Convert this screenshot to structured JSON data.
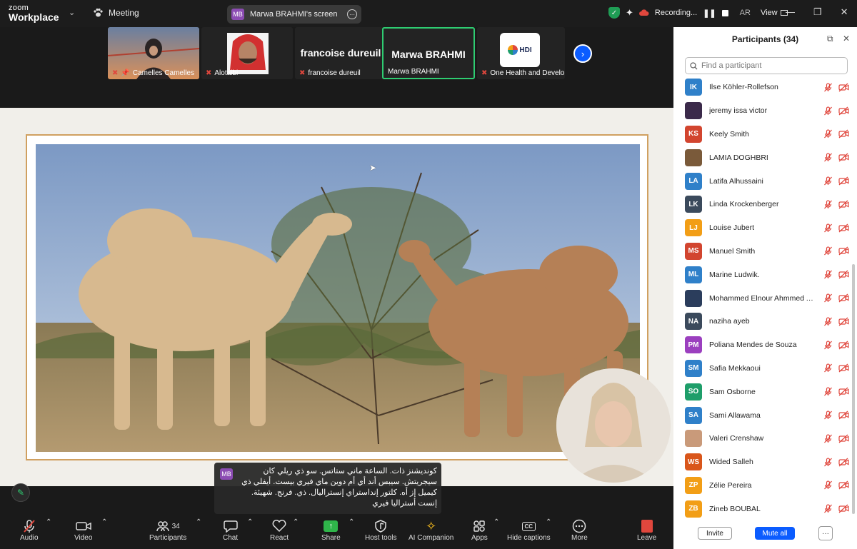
{
  "app": {
    "logo_top": "zoom",
    "logo_bottom": "Workplace"
  },
  "topbar": {
    "meeting_label": "Meeting",
    "screen_badge": "MB",
    "screen_label": "Marwa BRAHMI's screen",
    "recording_label": "Recording...",
    "lang": "AR",
    "view_label": "View"
  },
  "thumbnails": [
    {
      "name": "Camelles Camelles",
      "muted": true
    },
    {
      "name": "Alotaibi",
      "muted": true
    },
    {
      "name": "francoise dureuil",
      "big": "francoise dureuil",
      "muted": true
    },
    {
      "name": "Marwa BRAHMI",
      "big": "Marwa BRAHMI",
      "muted": false
    },
    {
      "name": "One Health and Develo...",
      "logo": "HDI",
      "muted": true
    }
  ],
  "caption": {
    "badge": "MB",
    "text": "كونديشنز ذات. الساعة ماني ستاتس. سو ذي ريلي كان سيجريتش. سيبس أند أي أم دوين ماي فيري بيست. أيفلي ذي كيميل إز أه. كلتور إنداستراي إنستراليال. ذي. فرنج. شهيئة. إنست أستراليا فيري"
  },
  "toolbar": {
    "audio": "Audio",
    "video": "Video",
    "participants": "Participants",
    "participants_count": "34",
    "chat": "Chat",
    "react": "React",
    "share": "Share",
    "host_tools": "Host tools",
    "ai_companion": "AI Companion",
    "apps": "Apps",
    "captions": "Hide captions",
    "more": "More",
    "leave": "Leave"
  },
  "panel": {
    "title": "Participants (34)",
    "search_placeholder": "Find a participant",
    "invite": "Invite",
    "mute_all": "Mute all"
  },
  "participants": [
    {
      "initials": "IK",
      "name": "Ilse Köhler-Rollefson",
      "color": "#2f80c9"
    },
    {
      "initials": "",
      "name": "jeremy issa victor",
      "color": "#3b2a4a"
    },
    {
      "initials": "KS",
      "name": "Keely Smith",
      "color": "#d2452f"
    },
    {
      "initials": "",
      "name": "LAMIA DOGHBRI",
      "color": "#7a5a3a"
    },
    {
      "initials": "LA",
      "name": "Latifa Alhussaini",
      "color": "#2f80c9"
    },
    {
      "initials": "LK",
      "name": "Linda Krockenberger",
      "color": "#3b4a5c"
    },
    {
      "initials": "LJ",
      "name": "Louise Jubert",
      "color": "#f29e16"
    },
    {
      "initials": "MS",
      "name": "Manuel Smith",
      "color": "#d2452f"
    },
    {
      "initials": "ML",
      "name": "Marine Ludwik.",
      "color": "#2f80c9"
    },
    {
      "initials": "",
      "name": "Mohammed Elnour Ahmmed A...",
      "color": "#2b3d5c"
    },
    {
      "initials": "NA",
      "name": "naziha ayeb",
      "color": "#3b4a5c"
    },
    {
      "initials": "PM",
      "name": "Poliana Mendes de Souza",
      "color": "#9b3fbf"
    },
    {
      "initials": "SM",
      "name": "Safia Mekkaoui",
      "color": "#2f80c9"
    },
    {
      "initials": "SO",
      "name": "Sam Osborne",
      "color": "#1e9e6a"
    },
    {
      "initials": "SA",
      "name": "Sami Allawama",
      "color": "#2f80c9"
    },
    {
      "initials": "",
      "name": "Valeri Crenshaw",
      "color": "#c99a7a"
    },
    {
      "initials": "WS",
      "name": "Wided Salleh",
      "color": "#d9561b"
    },
    {
      "initials": "ZP",
      "name": "Zélie Pereira",
      "color": "#f29e16"
    },
    {
      "initials": "ZB",
      "name": "Zineb BOUBAL",
      "color": "#f29e16"
    }
  ]
}
